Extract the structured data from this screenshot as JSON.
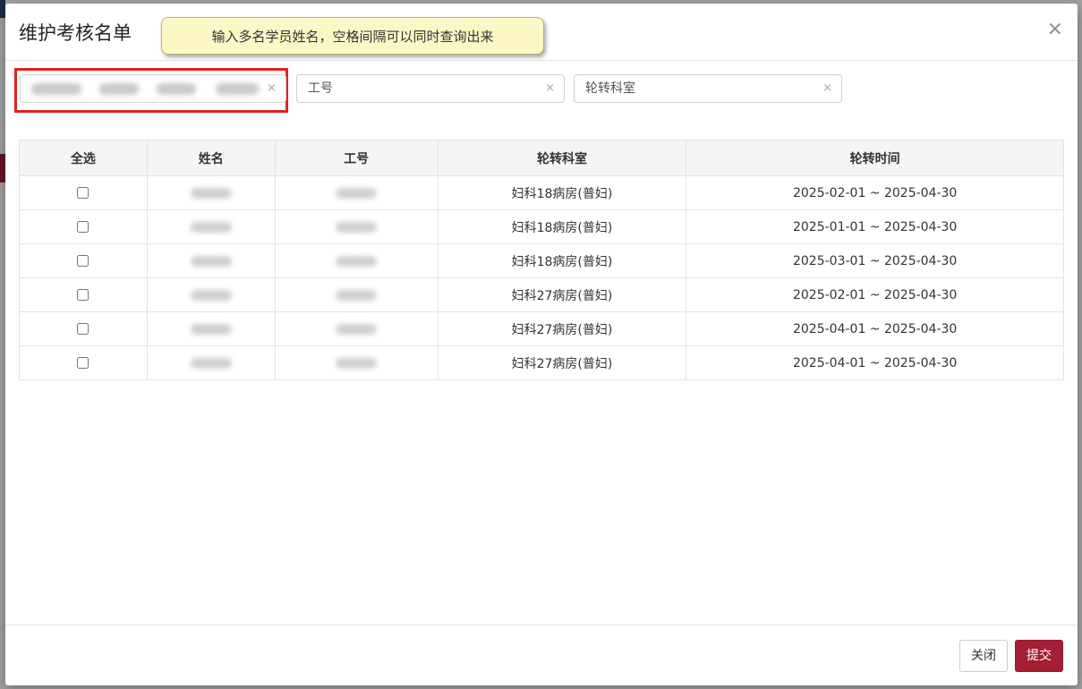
{
  "dialog": {
    "title": "维护考核名单",
    "close_symbol": "×",
    "tooltip": "输入多名学员姓名，空格间隔可以同时查询出来"
  },
  "filters": {
    "name_clear": "×",
    "id_placeholder": "工号",
    "id_clear": "×",
    "dept_placeholder": "轮转科室",
    "dept_clear": "×"
  },
  "table": {
    "headers": {
      "select_all": "全选",
      "name": "姓名",
      "id": "工号",
      "dept": "轮转科室",
      "period": "轮转时间"
    },
    "rows": [
      {
        "dept": "妇科18病房(普妇)",
        "period": "2025-02-01 ~ 2025-04-30"
      },
      {
        "dept": "妇科18病房(普妇)",
        "period": "2025-01-01 ~ 2025-04-30"
      },
      {
        "dept": "妇科18病房(普妇)",
        "period": "2025-03-01 ~ 2025-04-30"
      },
      {
        "dept": "妇科27病房(普妇)",
        "period": "2025-02-01 ~ 2025-04-30"
      },
      {
        "dept": "妇科27病房(普妇)",
        "period": "2025-04-01 ~ 2025-04-30"
      },
      {
        "dept": "妇科27病房(普妇)",
        "period": "2025-04-01 ~ 2025-04-30"
      }
    ]
  },
  "footer": {
    "close_label": "关闭",
    "submit_label": "提交"
  },
  "colors": {
    "submit_button": "#a41e34",
    "tooltip_background": "#fcf8c6",
    "highlight_border": "#e02020"
  }
}
